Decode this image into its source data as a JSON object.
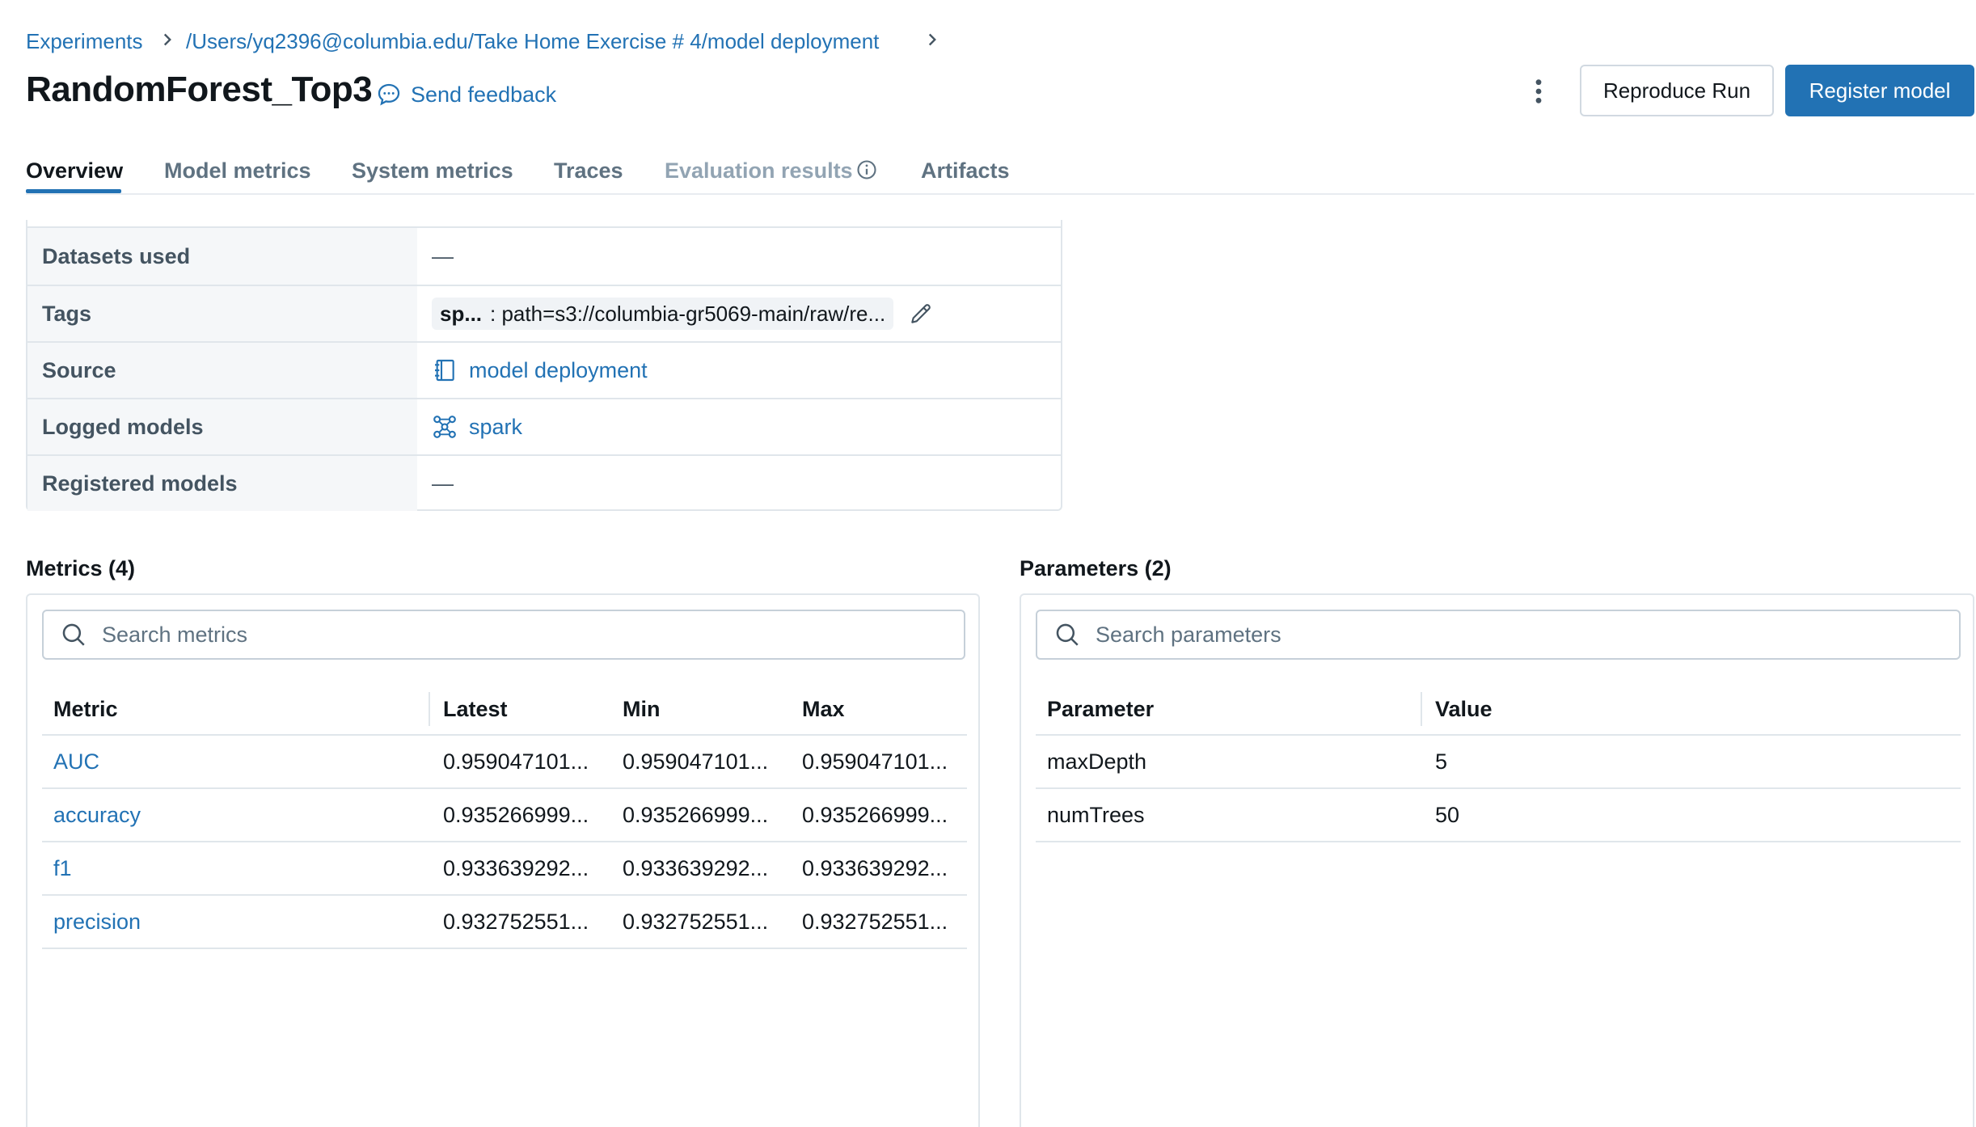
{
  "breadcrumb": {
    "experiments": "Experiments",
    "path": "/Users/yq2396@columbia.edu/Take Home Exercise # 4/model deployment"
  },
  "header": {
    "title": "RandomForest_Top3",
    "feedback": "Send feedback",
    "reproduce_label": "Reproduce Run",
    "register_label": "Register model"
  },
  "tabs": [
    {
      "label": "Overview"
    },
    {
      "label": "Model metrics"
    },
    {
      "label": "System metrics"
    },
    {
      "label": "Traces"
    },
    {
      "label": "Evaluation results"
    },
    {
      "label": "Artifacts"
    }
  ],
  "overview": {
    "datasets_label": "Datasets used",
    "datasets_value": "—",
    "tags_label": "Tags",
    "tag_key": "sp...",
    "tag_value": ": path=s3://columbia-gr5069-main/raw/re...",
    "source_label": "Source",
    "source_value": "model deployment",
    "logged_label": "Logged models",
    "logged_value": "spark",
    "registered_label": "Registered models",
    "registered_value": "—"
  },
  "metrics": {
    "title": "Metrics (4)",
    "search_placeholder": "Search metrics",
    "headers": [
      "Metric",
      "Latest",
      "Min",
      "Max"
    ],
    "rows": [
      [
        "AUC",
        "0.959047101...",
        "0.959047101...",
        "0.959047101..."
      ],
      [
        "accuracy",
        "0.935266999...",
        "0.935266999...",
        "0.935266999..."
      ],
      [
        "f1",
        "0.933639292...",
        "0.933639292...",
        "0.933639292..."
      ],
      [
        "precision",
        "0.932752551...",
        "0.932752551...",
        "0.932752551..."
      ]
    ]
  },
  "parameters": {
    "title": "Parameters (2)",
    "search_placeholder": "Search parameters",
    "headers": [
      "Parameter",
      "Value"
    ],
    "rows": [
      [
        "maxDepth",
        "5"
      ],
      [
        "numTrees",
        "50"
      ]
    ]
  },
  "colors": {
    "accent": "#2272b4",
    "text": "#11171c",
    "muted": "#5f7281",
    "border": "#e0e6eb"
  }
}
